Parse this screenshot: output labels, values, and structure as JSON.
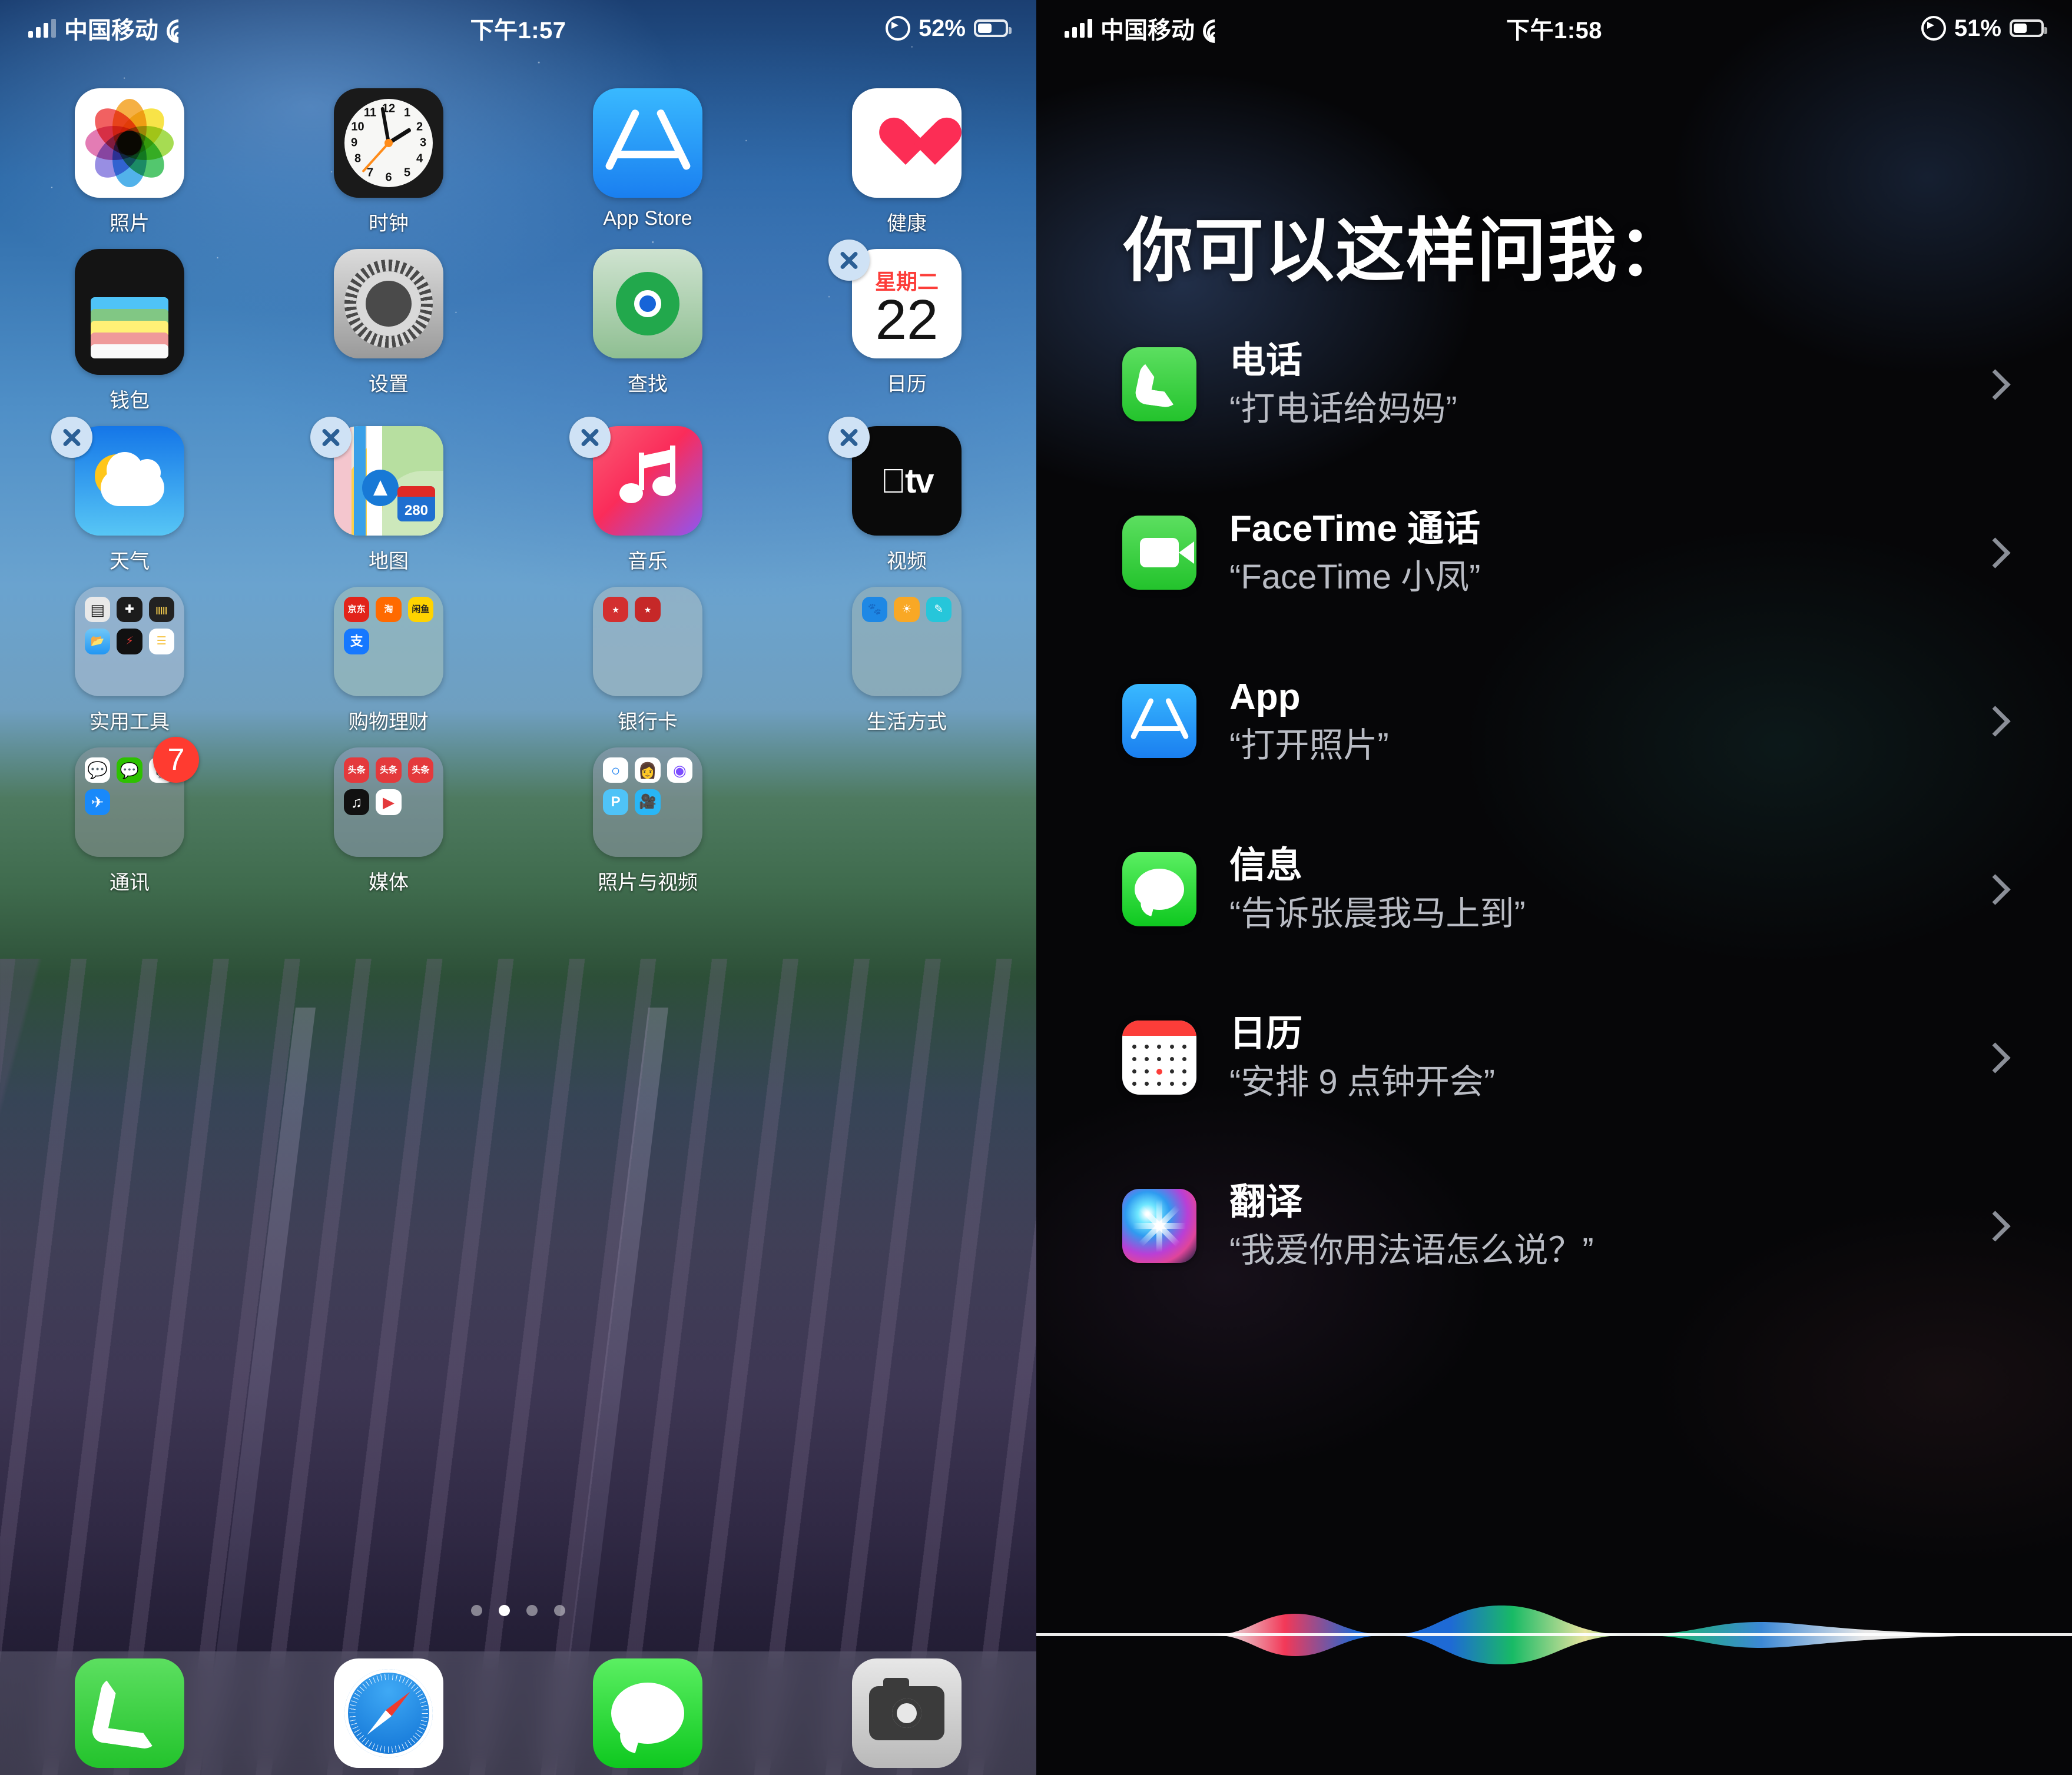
{
  "left_phone": {
    "status_bar": {
      "carrier": "中国移动",
      "time": "下午1:57",
      "battery_percent": "52%",
      "signal_icon": "cellular-bars-icon",
      "wifi_icon": "wifi-icon",
      "location_icon": "location-services-icon",
      "battery_icon": "battery-icon"
    },
    "edit_mode": true,
    "rows": [
      {
        "apps": [
          {
            "label": "照片",
            "icon": "photos-icon",
            "removable": false
          },
          {
            "label": "时钟",
            "icon": "clock-icon",
            "removable": false
          },
          {
            "label": "App Store",
            "icon": "app-store-icon",
            "removable": false
          },
          {
            "label": "健康",
            "icon": "health-icon",
            "removable": false
          }
        ]
      },
      {
        "apps": [
          {
            "label": "钱包",
            "icon": "wallet-icon",
            "removable": false
          },
          {
            "label": "设置",
            "icon": "settings-icon",
            "removable": false
          },
          {
            "label": "查找",
            "icon": "find-my-icon",
            "removable": false
          },
          {
            "label": "日历",
            "icon": "calendar-icon",
            "removable": true,
            "calendar_weekday": "星期二",
            "calendar_day": "22"
          }
        ]
      },
      {
        "apps": [
          {
            "label": "天气",
            "icon": "weather-icon",
            "removable": true
          },
          {
            "label": "地图",
            "icon": "maps-icon",
            "removable": true,
            "highway_shield": "280"
          },
          {
            "label": "音乐",
            "icon": "music-icon",
            "removable": true
          },
          {
            "label": "视频",
            "icon": "apple-tv-icon",
            "removable": false,
            "glyph": "tv"
          }
        ]
      },
      {
        "apps": [
          {
            "label": "实用工具",
            "icon": "folder-icon",
            "folder": true,
            "mini": [
              "计算器",
              "指南针",
              "测距仪",
              "文件",
              "语音备忘录",
              "备忘录"
            ]
          },
          {
            "label": "购物理财",
            "icon": "folder-icon",
            "folder": true,
            "mini": [
              "京东",
              "淘宝",
              "闲鱼",
              "支付宝"
            ]
          },
          {
            "label": "银行卡",
            "icon": "folder-icon",
            "folder": true,
            "mini": [
              "银行A",
              "银行B"
            ]
          },
          {
            "label": "生活方式",
            "icon": "folder-icon",
            "folder": true,
            "mini": [
              "健身",
              "美团",
              "小红书"
            ]
          }
        ]
      },
      {
        "apps": [
          {
            "label": "通讯",
            "icon": "folder-icon",
            "folder": true,
            "badge": "7",
            "mini": [
              "企业微信",
              "微信",
              "QQ",
              "钉钉"
            ]
          },
          {
            "label": "媒体",
            "icon": "folder-icon",
            "folder": true,
            "mini": [
              "头条",
              "头条",
              "头条",
              "抖音",
              "西瓜"
            ]
          },
          {
            "label": "照片与视频",
            "icon": "folder-icon",
            "folder": true,
            "mini": [
              "修图",
              "美颜",
              "相机",
              "P图",
              "剪辑"
            ]
          }
        ]
      }
    ],
    "page_dots": {
      "count": 4,
      "active_index": 1
    },
    "dock": [
      {
        "label": "电话",
        "icon": "phone-icon"
      },
      {
        "label": "Safari 浏览器",
        "icon": "safari-icon"
      },
      {
        "label": "信息",
        "icon": "messages-icon"
      },
      {
        "label": "相机",
        "icon": "camera-icon"
      }
    ]
  },
  "right_phone": {
    "status_bar": {
      "carrier": "中国移动",
      "time": "下午1:58",
      "battery_percent": "51%",
      "signal_icon": "cellular-bars-icon",
      "wifi_icon": "wifi-icon",
      "location_icon": "location-services-icon",
      "battery_icon": "battery-icon"
    },
    "title": "你可以这样问我：",
    "suggestions": [
      {
        "name": "电话",
        "example": "“打电话给妈妈”",
        "icon": "phone-icon",
        "chevron": "chevron-right-icon"
      },
      {
        "name": "FaceTime 通话",
        "example": "“FaceTime 小凤”",
        "icon": "facetime-icon",
        "chevron": "chevron-right-icon"
      },
      {
        "name": "App",
        "example": "“打开照片”",
        "icon": "app-store-icon",
        "chevron": "chevron-right-icon"
      },
      {
        "name": "信息",
        "example": "“告诉张晨我马上到”",
        "icon": "messages-icon",
        "chevron": "chevron-right-icon"
      },
      {
        "name": "日历",
        "example": "“安排 9 点钟开会”",
        "icon": "calendar-icon",
        "chevron": "chevron-right-icon"
      },
      {
        "name": "翻译",
        "example": "“我爱你用法语怎么说？”",
        "icon": "siri-orb-icon",
        "chevron": "chevron-right-icon"
      }
    ],
    "waveform_icon": "siri-waveform-icon"
  },
  "colors": {
    "ios_green": "#23c32c",
    "ios_blue": "#1a7ff0",
    "ios_red": "#fc3d39",
    "badge_red": "#ff3b30",
    "delete_badge_bg": "#cfe2f5",
    "siri_bg": "#060608",
    "text_primary": "#ffffff",
    "text_secondary": "#b9bcc4"
  }
}
